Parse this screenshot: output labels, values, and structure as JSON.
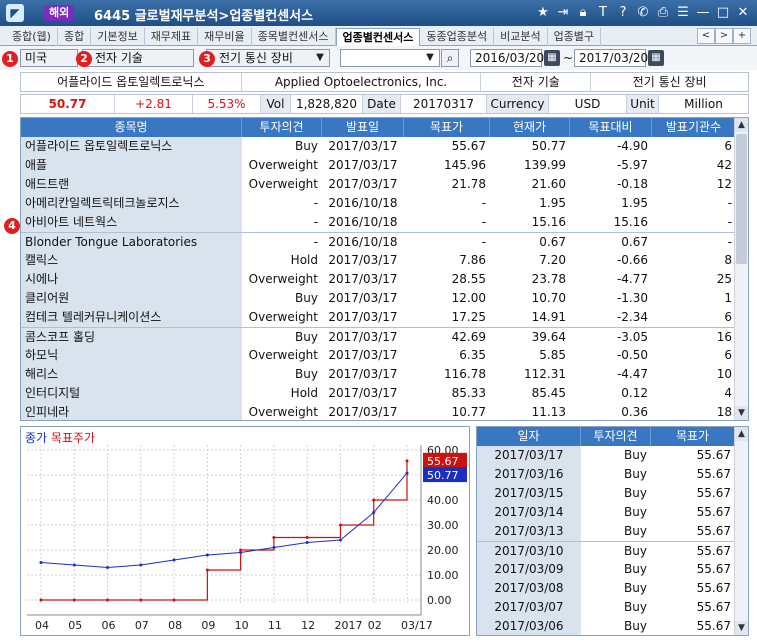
{
  "titlebar": {
    "badge": "해외",
    "title": "6445 글로벌재무분석>업종별컨센서스",
    "icons": [
      "star-icon",
      "export-icon",
      "lock-icon",
      "text-icon",
      "help-icon",
      "phone-icon",
      "print-icon",
      "menu-icon",
      "minimize-icon",
      "maximize-icon",
      "close-icon"
    ]
  },
  "tabs": [
    {
      "label": "종합(웹)"
    },
    {
      "label": "종합"
    },
    {
      "label": "기본정보"
    },
    {
      "label": "재무제표"
    },
    {
      "label": "재무비율"
    },
    {
      "label": "종목별컨센서스"
    },
    {
      "label": "업종별컨센서스",
      "active": true
    },
    {
      "label": "동종업종분석"
    },
    {
      "label": "비교분석"
    },
    {
      "label": "업종별구"
    }
  ],
  "tabnav": {
    "prev": "<",
    "next": ">",
    "add": "+"
  },
  "filters": {
    "country": "미국",
    "sector": "전자 기술",
    "industry": "전기 통신 장비",
    "search_value": "",
    "date_from": "2016/03/20",
    "date_sep": "~",
    "date_to": "2017/03/20",
    "badges": [
      "1",
      "2",
      "3",
      "4"
    ]
  },
  "company": {
    "name_ko": "어플라이드 옵토일렉트로닉스",
    "name_en": "Applied Optoelectronics, Inc.",
    "sector": "전자 기술",
    "industry": "전기 통신 장비"
  },
  "quote": {
    "price": "50.77",
    "change": "+2.81",
    "change_pct": "5.53%",
    "vol_label": "Vol",
    "vol": "1,828,820",
    "date_label": "Date",
    "date": "20170317",
    "currency_label": "Currency",
    "currency": "USD",
    "unit_label": "Unit",
    "unit": "Million"
  },
  "table": {
    "headers": [
      "종목명",
      "투자의견",
      "발표일",
      "목표가",
      "현재가",
      "목표대비",
      "발표기관수"
    ],
    "rows": [
      [
        "어플라이드 옵토일렉트로닉스",
        "Buy",
        "2017/03/17",
        "55.67",
        "50.77",
        "-4.90",
        "6"
      ],
      [
        "애플",
        "Overweight",
        "2017/03/17",
        "145.96",
        "139.99",
        "-5.97",
        "42"
      ],
      [
        "애드트랜",
        "Overweight",
        "2017/03/17",
        "21.78",
        "21.60",
        "-0.18",
        "12"
      ],
      [
        "아메리칸일렉트릭테크놀로지스",
        "-",
        "2016/10/18",
        "-",
        "1.95",
        "1.95",
        "-"
      ],
      [
        "아비아트 네트웍스",
        "-",
        "2016/10/18",
        "-",
        "15.16",
        "15.16",
        "-"
      ],
      [
        "Blonder Tongue Laboratories",
        "-",
        "2016/10/18",
        "-",
        "0.67",
        "0.67",
        "-"
      ],
      [
        "캘릭스",
        "Hold",
        "2017/03/17",
        "7.86",
        "7.20",
        "-0.66",
        "8"
      ],
      [
        "시에나",
        "Overweight",
        "2017/03/17",
        "28.55",
        "23.78",
        "-4.77",
        "25"
      ],
      [
        "클리어원",
        "Buy",
        "2017/03/17",
        "12.00",
        "10.70",
        "-1.30",
        "1"
      ],
      [
        "컴테크 텔레커뮤니케이션스",
        "Overweight",
        "2017/03/17",
        "17.25",
        "14.91",
        "-2.34",
        "6"
      ],
      [
        "콤스코프 홀딩",
        "Buy",
        "2017/03/17",
        "42.69",
        "39.64",
        "-3.05",
        "16"
      ],
      [
        "하모닉",
        "Overweight",
        "2017/03/17",
        "6.35",
        "5.85",
        "-0.50",
        "6"
      ],
      [
        "해리스",
        "Buy",
        "2017/03/17",
        "116.78",
        "112.31",
        "-4.47",
        "10"
      ],
      [
        "인터디지털",
        "Hold",
        "2017/03/17",
        "85.33",
        "85.45",
        "0.12",
        "4"
      ],
      [
        "인피네라",
        "Overweight",
        "2017/03/17",
        "10.77",
        "11.13",
        "0.36",
        "18"
      ]
    ]
  },
  "chart": {
    "legend_price": "종가",
    "legend_target": "목표주가",
    "price_color": "#1a2fbf",
    "target_color": "#cc1111",
    "target_marker": "55.67",
    "price_marker": "50.77",
    "yticks": [
      "60.00",
      "50.00",
      "40.00",
      "30.00",
      "20.00",
      "10.00",
      "0.00"
    ],
    "xticks": [
      "04",
      "05",
      "06",
      "07",
      "08",
      "09",
      "10",
      "11",
      "12",
      "2017",
      "02",
      "03/17"
    ]
  },
  "chart_data": {
    "type": "line",
    "title": "",
    "xlabel": "",
    "ylabel": "",
    "ylim": [
      -2,
      62
    ],
    "categories": [
      "04",
      "05",
      "06",
      "07",
      "08",
      "09",
      "10",
      "11",
      "12",
      "2017",
      "02",
      "03/17"
    ],
    "series": [
      {
        "name": "종가",
        "values": [
          15,
          14,
          13,
          14,
          16,
          18,
          19,
          21,
          23,
          24,
          35,
          50.77
        ]
      },
      {
        "name": "목표주가",
        "values": [
          0,
          0,
          0,
          0,
          0,
          12,
          20,
          25,
          25,
          30,
          40,
          55.67
        ]
      }
    ]
  },
  "rtable": {
    "headers": [
      "일자",
      "투자의견",
      "목표가"
    ],
    "rows": [
      [
        "2017/03/17",
        "Buy",
        "55.67"
      ],
      [
        "2017/03/16",
        "Buy",
        "55.67"
      ],
      [
        "2017/03/15",
        "Buy",
        "55.67"
      ],
      [
        "2017/03/14",
        "Buy",
        "55.67"
      ],
      [
        "2017/03/13",
        "Buy",
        "55.67"
      ],
      [
        "2017/03/10",
        "Buy",
        "55.67"
      ],
      [
        "2017/03/09",
        "Buy",
        "55.67"
      ],
      [
        "2017/03/08",
        "Buy",
        "55.67"
      ],
      [
        "2017/03/07",
        "Buy",
        "55.67"
      ],
      [
        "2017/03/06",
        "Buy",
        "55.67"
      ]
    ]
  }
}
